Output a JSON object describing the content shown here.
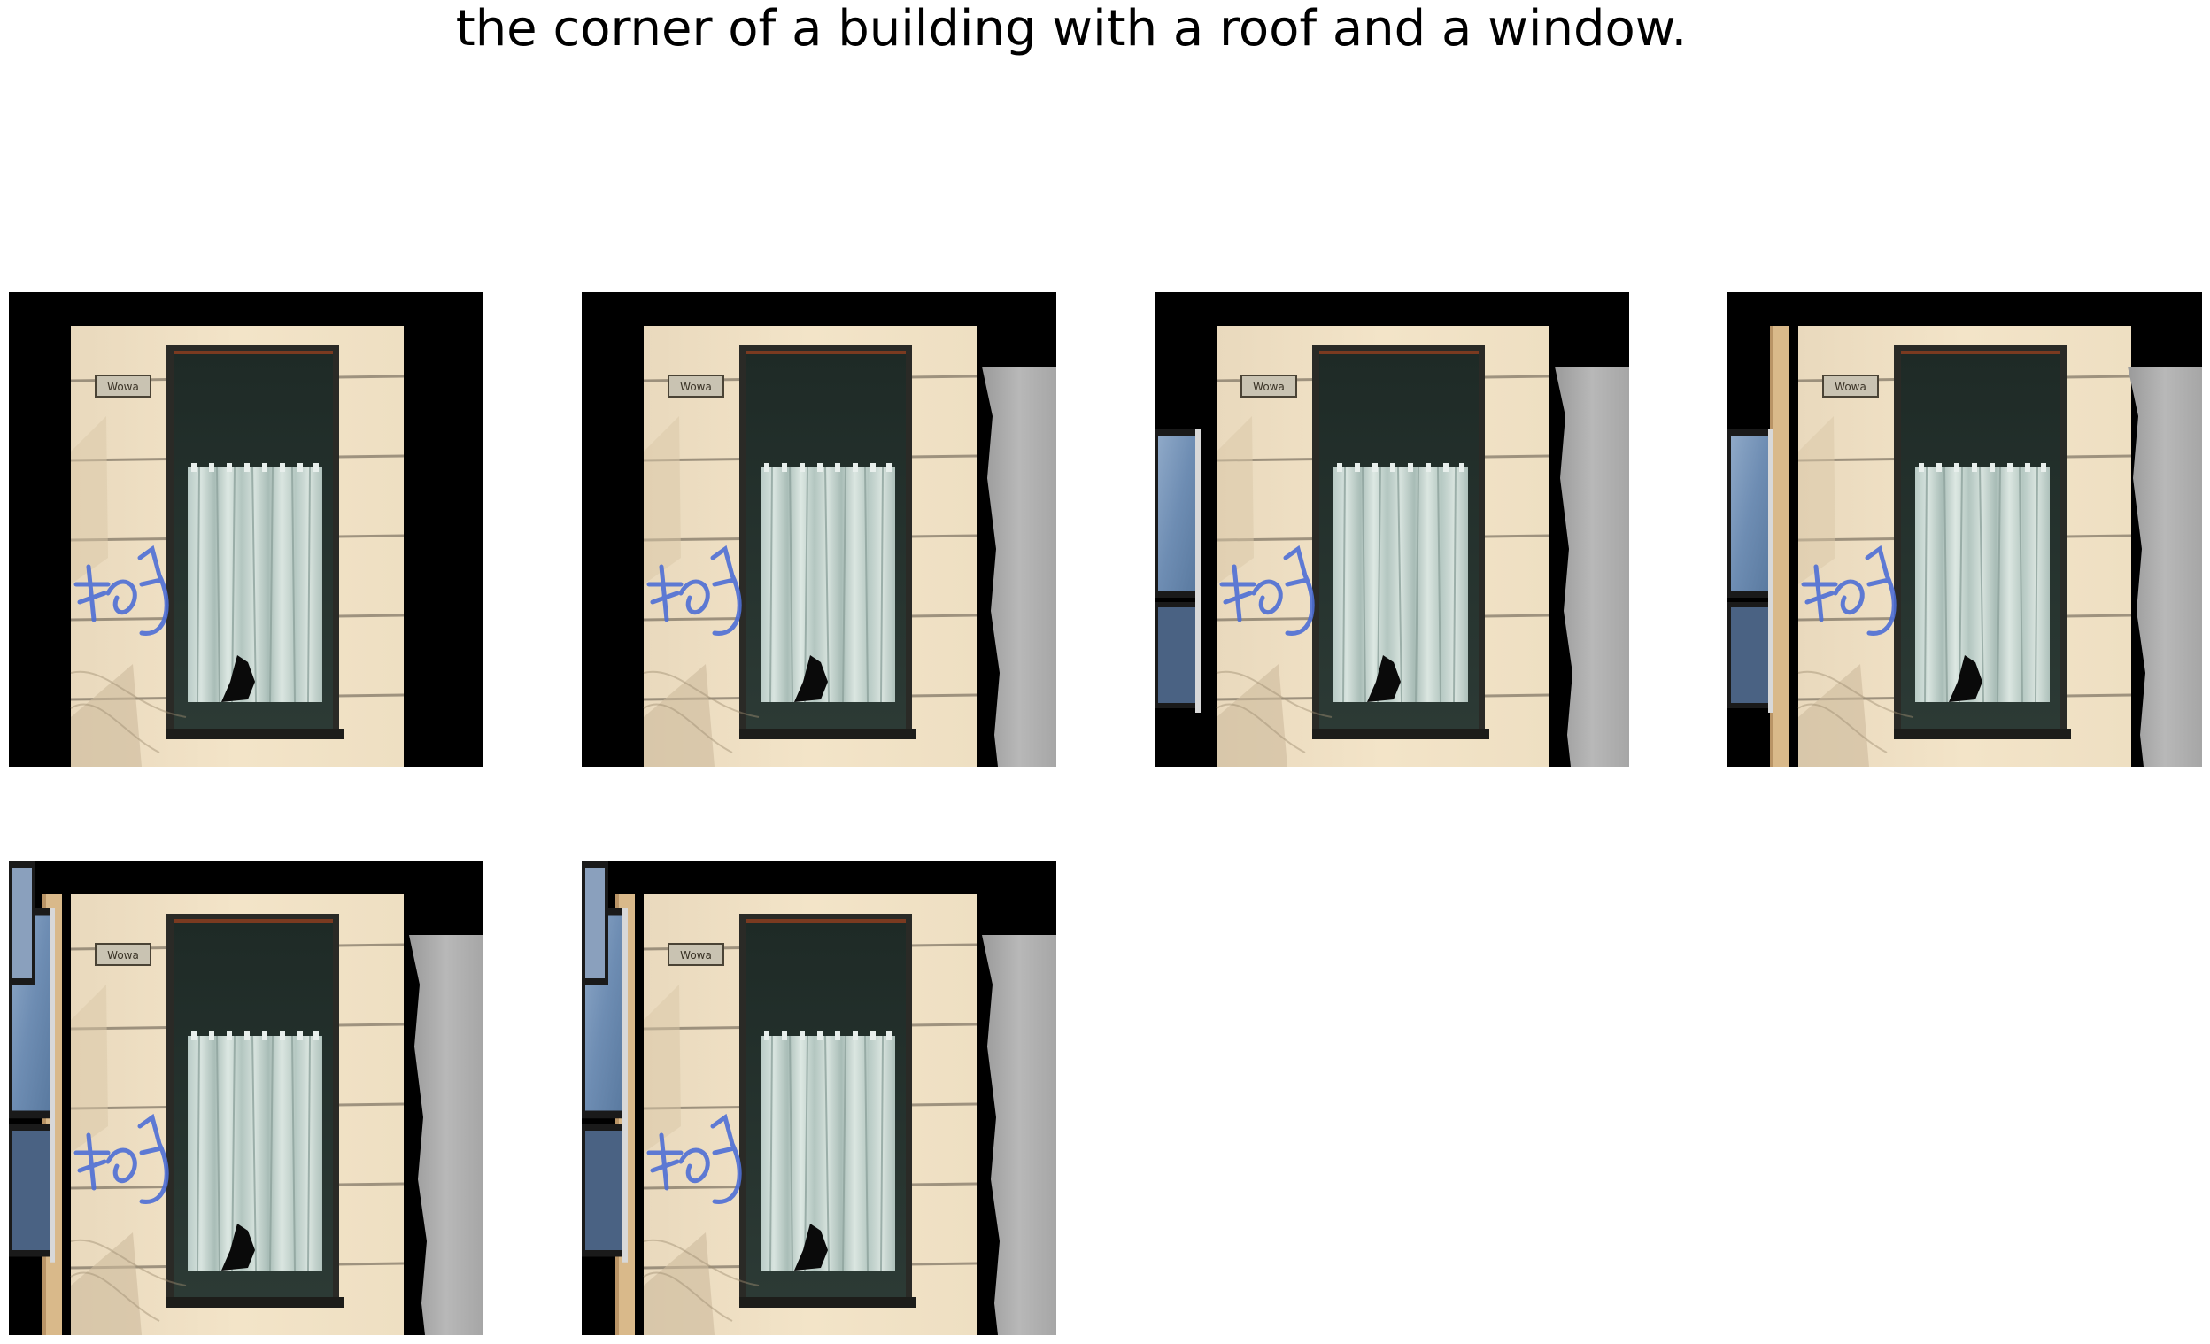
{
  "caption": "the corner of a building with a roof and a window.",
  "panels": [
    {
      "variant": "base"
    },
    {
      "variant": "with-gray-wall-right"
    },
    {
      "variant": "with-blue-window-left"
    },
    {
      "variant": "with-blue-window-left-and-gray-wall"
    },
    {
      "variant": "shifted-with-blue-window"
    },
    {
      "variant": "shifted-with-blue-window-2"
    }
  ],
  "plaque_text": "Wowa"
}
